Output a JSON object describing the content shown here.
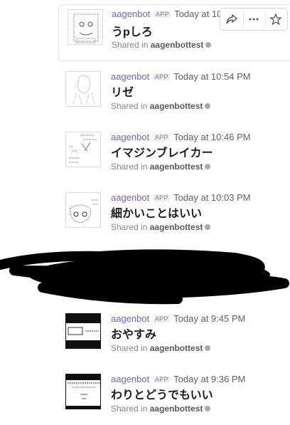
{
  "messages": [
    {
      "sender": "aagenbot",
      "badge": "APP",
      "time": "Today at 10:",
      "title": "うpしろ",
      "shared_prefix": "Shared in",
      "channel": "aagenbottest",
      "thumbnail": "ascii-art-face"
    },
    {
      "sender": "aagenbot",
      "badge": "APP",
      "time": "Today at 10:54 PM",
      "title": "リゼ",
      "shared_prefix": "Shared in",
      "channel": "aagenbottest",
      "thumbnail": "ascii-art-figure"
    },
    {
      "sender": "aagenbot",
      "badge": "APP",
      "time": "Today at 10:46 PM",
      "title": "イマジンブレイカー",
      "shared_prefix": "Shared in",
      "channel": "aagenbottest",
      "thumbnail": "ascii-art-text"
    },
    {
      "sender": "aagenbot",
      "badge": "APP",
      "time": "Today at 10:03 PM",
      "title": "細かいことはいい",
      "shared_prefix": "Shared in",
      "channel": "aagenbottest",
      "thumbnail": "ascii-art-creature"
    },
    {
      "sender": "aagenbot",
      "badge": "APP",
      "time": "Today at 9:45 PM",
      "title": "おやすみ",
      "shared_prefix": "Shared in",
      "channel": "aagenbottest",
      "thumbnail": "ascii-art-dark-banner"
    },
    {
      "sender": "aagenbot",
      "badge": "APP",
      "time": "Today at 9:36 PM",
      "title": "わりとどうでもいい",
      "shared_prefix": "Shared in",
      "channel": "aagenbottest",
      "thumbnail": "ascii-art-dark-lines"
    }
  ],
  "toolbar": {
    "icons": [
      "share-icon",
      "more-icon",
      "star-icon"
    ]
  },
  "colors": {
    "sender": "#7a63b8",
    "redaction": "#000000"
  }
}
